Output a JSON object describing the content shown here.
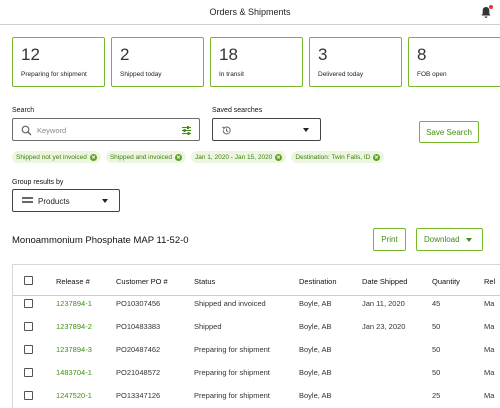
{
  "header": {
    "title": "Orders & Shipments"
  },
  "colors": {
    "accent": "#76b82a",
    "link": "#3f8f10",
    "notification": "#e53935"
  },
  "summary_cards": [
    {
      "count": "12",
      "label": "Preparing for shipment"
    },
    {
      "count": "2",
      "label": "Shipped today"
    },
    {
      "count": "18",
      "label": "In transit"
    },
    {
      "count": "3",
      "label": "Delivered today"
    },
    {
      "count": "8",
      "label": "FOB open"
    }
  ],
  "search": {
    "label": "Search",
    "placeholder": "Keyword"
  },
  "saved_searches": {
    "label": "Saved searches",
    "value": ""
  },
  "save_search_button": "Save Search",
  "filters": [
    "Shipped not yet invoiced",
    "Shipped and invoiced",
    "Jan 1, 2020 - Jan 15, 2020",
    "Destination: Twin Falls, ID"
  ],
  "group_by": {
    "label": "Group results by",
    "value": "Products"
  },
  "product": {
    "title": "Monoammonium Phosphate MAP 11-52-0"
  },
  "actions": {
    "print": "Print",
    "download": "Download"
  },
  "table": {
    "columns": [
      "Release #",
      "Customer PO #",
      "Status",
      "Destination",
      "Date Shipped",
      "Quantity",
      "Rel"
    ],
    "rows": [
      {
        "release": "1237894-1",
        "po": "PO10307456",
        "status": "Shipped and invoiced",
        "destination": "Boyle, AB",
        "date": "Jan 11, 2020",
        "quantity": "45",
        "rel": "Ma"
      },
      {
        "release": "1237894-2",
        "po": "PO10483383",
        "status": "Shipped",
        "destination": "Boyle, AB",
        "date": "Jan 23, 2020",
        "quantity": "50",
        "rel": "Ma"
      },
      {
        "release": "1237894-3",
        "po": "PO20487462",
        "status": "Preparing for shipment",
        "destination": "Boyle, AB",
        "date": "",
        "quantity": "50",
        "rel": "Ma"
      },
      {
        "release": "1483704-1",
        "po": "PO21048572",
        "status": "Preparing for shipment",
        "destination": "Boyle, AB",
        "date": "",
        "quantity": "50",
        "rel": "Ma"
      },
      {
        "release": "1247520-1",
        "po": "PO13347126",
        "status": "Preparing for shipment",
        "destination": "Boyle, AB",
        "date": "",
        "quantity": "25",
        "rel": "Ma"
      }
    ]
  }
}
